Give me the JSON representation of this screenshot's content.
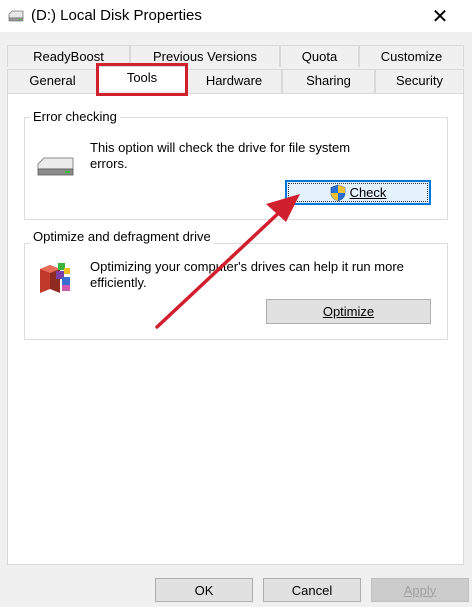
{
  "window": {
    "title": "(D:) Local Disk Properties",
    "title_icon": "drive-icon",
    "close_glyph": "✕"
  },
  "tabs": {
    "back_row": [
      "ReadyBoost",
      "Previous Versions",
      "Quota",
      "Customize"
    ],
    "front_row": [
      "General",
      "Tools",
      "Hardware",
      "Sharing",
      "Security"
    ],
    "active": "Tools"
  },
  "error_checking": {
    "title": "Error checking",
    "icon": "drive-icon",
    "description_line1": "This option will check the drive for file system",
    "description_line2": "errors.",
    "button_label": "Check",
    "button_icon": "uac-shield-icon"
  },
  "optimize": {
    "title": "Optimize and defragment drive",
    "icon": "defrag-icon",
    "description_line1": "Optimizing your computer's drives can help it run more",
    "description_line2": "efficiently.",
    "button_label": "Optimize"
  },
  "footer": {
    "ok_label": "OK",
    "cancel_label": "Cancel",
    "apply_label": "Apply"
  },
  "annotation": {
    "highlight_color": "#d0202e",
    "arrow_color": "#d0202e"
  }
}
